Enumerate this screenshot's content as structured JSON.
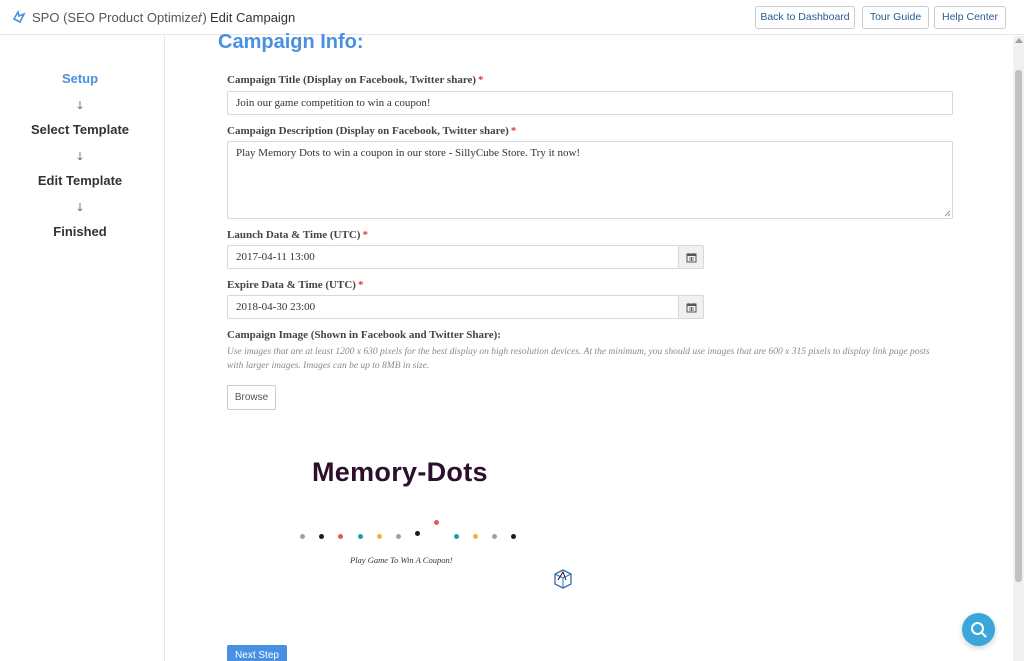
{
  "header": {
    "app_name": "SPO (SEO Product Optimizer)",
    "separator": "/",
    "page_name": "Edit Campaign",
    "buttons": {
      "dashboard": "Back to Dashboard",
      "tour": "Tour Guide",
      "help": "Help Center"
    }
  },
  "sidebar": {
    "steps": [
      "Setup",
      "Select Template",
      "Edit Template",
      "Finished"
    ],
    "arrow": "🡓",
    "active_step": "Setup"
  },
  "main": {
    "section_title": "Campaign Info:",
    "title_field": {
      "label": "Campaign Title (Display on Facebook, Twitter share)",
      "required": "*",
      "value": "Join our game competition to win a coupon!"
    },
    "description_field": {
      "label": "Campaign Description (Display on Facebook, Twitter share)",
      "required": "*",
      "value": "Play Memory Dots to win a coupon in our store - SillyCube Store. Try it now!"
    },
    "launch_field": {
      "label": "Launch Data & Time (UTC)",
      "required": "*",
      "value": "2017-04-11 13:00"
    },
    "expire_field": {
      "label": "Expire Data & Time (UTC)",
      "required": "*",
      "value": "2018-04-30 23:00"
    },
    "image_field": {
      "label": "Campaign Image (Shown in Facebook and Twitter Share):",
      "hint": "Use images that are at least 1200 x 630 pixels for the best display on high resolution devices. At the minimum, you should use images that are 600 x 315 pixels to display link page posts with larger images. Images can be up to 8MB in size.",
      "browse_label": "Browse"
    },
    "preview": {
      "title": "Memory-Dots",
      "tagline": "Play Game To Win A Coupon!",
      "dot_colors": [
        "#a0a0a0",
        "#2b0f2c",
        "#e05a5a",
        "#17a2a2",
        "#f2b33d",
        "#a0a0a0",
        "#2b0f2c",
        "#e05a5a",
        "#17a2a2",
        "#f2b33d",
        "#a0a0a0",
        "#2b0f2c"
      ]
    },
    "next_button": "Next Step"
  },
  "colors": {
    "accent": "#4a90e2",
    "required": "#e23b3b",
    "help_fab": "#3aa6d9"
  },
  "icons": [
    "brand-logo-icon",
    "calendar-icon",
    "search-icon",
    "arrow-down-icon",
    "cube-logo-icon"
  ]
}
